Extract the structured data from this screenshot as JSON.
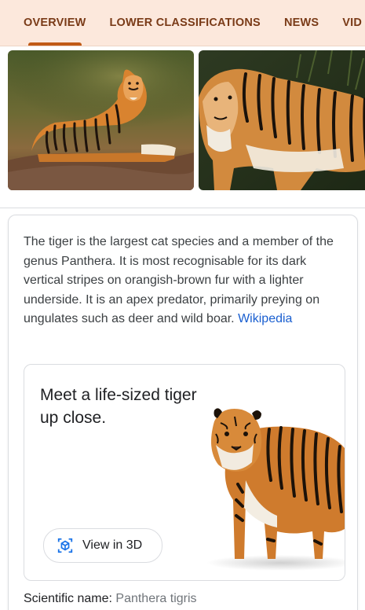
{
  "tabs": [
    {
      "label": "OVERVIEW",
      "active": true
    },
    {
      "label": "LOWER CLASSIFICATIONS",
      "active": false
    },
    {
      "label": "NEWS",
      "active": false
    },
    {
      "label": "VID",
      "active": false
    }
  ],
  "description": {
    "text": "The tiger is the largest cat species and a member of the genus Panthera. It is most recognisable for its dark vertical stripes on orangish-brown fur with a lighter underside. It is an apex predator, primarily preying on ungulates such as deer and wild boar.",
    "source_link": "Wikipedia"
  },
  "ar_card": {
    "title": "Meet a life-sized tiger up close.",
    "button_label": "View in 3D",
    "button_icon": "cube-3d-icon"
  },
  "facts": {
    "scientific_name_label": "Scientific name:",
    "scientific_name_value": "Panthera tigris"
  },
  "colors": {
    "tabbar_bg": "#fce8dc",
    "tab_text": "#7a3b18",
    "tab_indicator": "#c15a16",
    "link": "#1a5fd0"
  }
}
